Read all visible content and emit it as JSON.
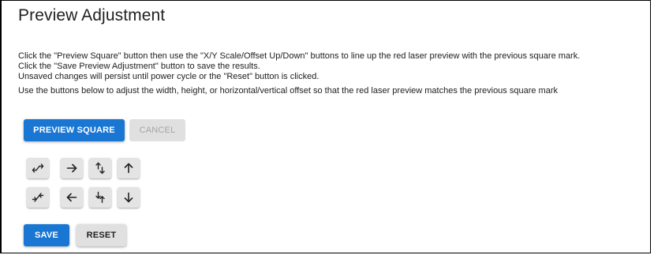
{
  "header": {
    "title": "Preview Adjustment"
  },
  "instructions": {
    "line1": "Click the \"Preview Square\" button then use the \"X/Y Scale/Offset Up/Down\" buttons to line up the red laser preview with the previous square mark.",
    "line2": "Click the \"Save Preview Adjustment\" button to save the results.",
    "line3": "Unsaved changes will persist until power cycle or the \"Reset\" button is clicked.",
    "line4": "Use the buttons below to adjust the width, height, or horizontal/vertical offset so that the red laser preview matches the previous square mark"
  },
  "actions": {
    "preview_label": "PREVIEW SQUARE",
    "cancel_label": "CANCEL",
    "save_label": "SAVE",
    "reset_label": "RESET"
  },
  "adjust_buttons": {
    "row1": [
      "x-scale-up-icon",
      "x-offset-right-icon",
      "y-scale-up-icon",
      "y-offset-up-icon"
    ],
    "row2": [
      "x-scale-down-icon",
      "x-offset-left-icon",
      "y-scale-down-icon",
      "y-offset-down-icon"
    ]
  },
  "colors": {
    "primary": "#1976d2",
    "disabled_bg": "#e0e0e0",
    "disabled_text": "#a6a6a6",
    "text": "#212121"
  }
}
